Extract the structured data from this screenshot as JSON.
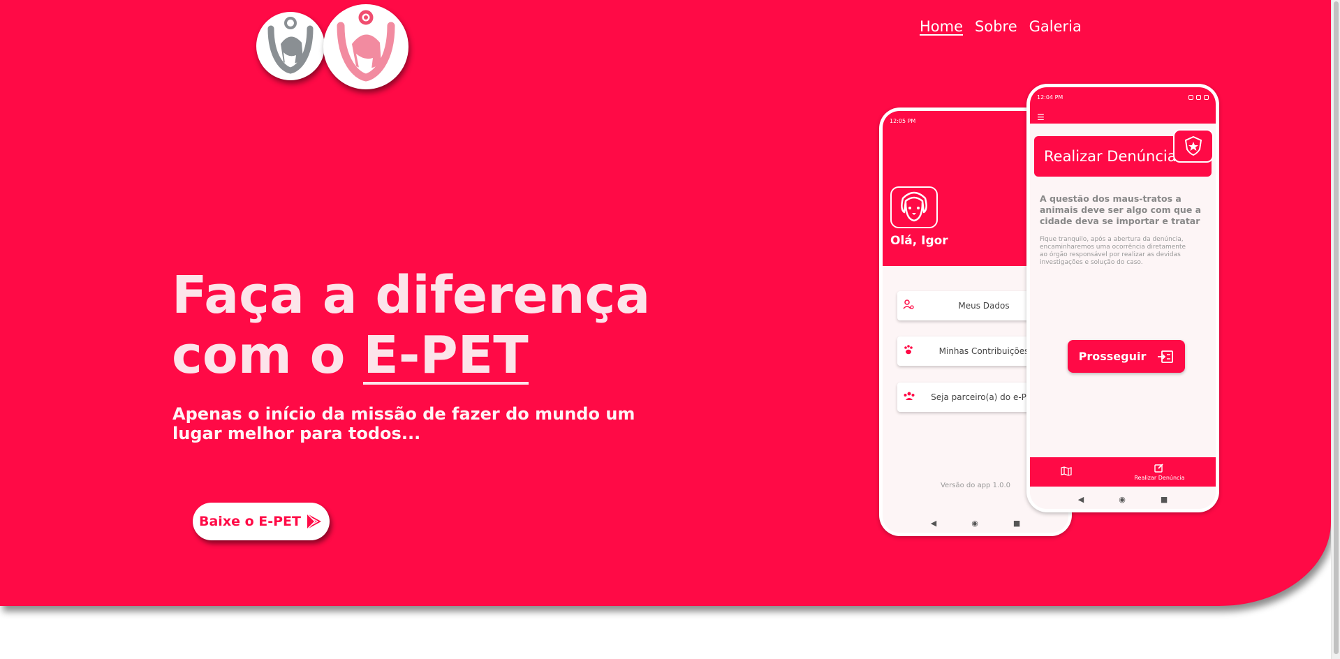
{
  "colors": {
    "brand": "#ff0a46",
    "text_light": "#fce4ea",
    "white": "#ffffff"
  },
  "nav": {
    "items": [
      {
        "label": "Home",
        "active": true
      },
      {
        "label": "Sobre",
        "active": false
      },
      {
        "label": "Galeria",
        "active": false
      }
    ]
  },
  "hero": {
    "headline_line1": "Faça a diferença",
    "headline_prefix": "com o",
    "headline_brand": "E-PET",
    "subtitle": "Apenas o início da missão de fazer do mundo um lugar melhor para todos...",
    "cta_label": "Baixe o E-PET",
    "cta_icon": "play-store-icon"
  },
  "phone1": {
    "time": "12:05 PM",
    "greeting": "Olá, Igor",
    "menu": [
      {
        "label": "Meus Dados",
        "icon": "user-settings-icon"
      },
      {
        "label": "Minhas Contribuições",
        "icon": "paw-icon"
      },
      {
        "label": "Seja parceiro(a) do e-PET",
        "icon": "group-icon"
      }
    ],
    "version": "Versão do app 1.0.0"
  },
  "phone2": {
    "time": "12:04 PM",
    "title": "Realizar Denúncia",
    "heading": "A questão dos maus-tratos a animais deve ser algo com que a cidade deva se importar e tratar",
    "body": "Fique tranquilo, após a abertura da denúncia, encaminharemos uma ocorrência diretamente ao órgão responsável por realizar as devidas investigações e solução do caso.",
    "button_label": "Prosseguir",
    "tab_map_label": "",
    "tab_report_label": "Realizar Denúncia"
  }
}
